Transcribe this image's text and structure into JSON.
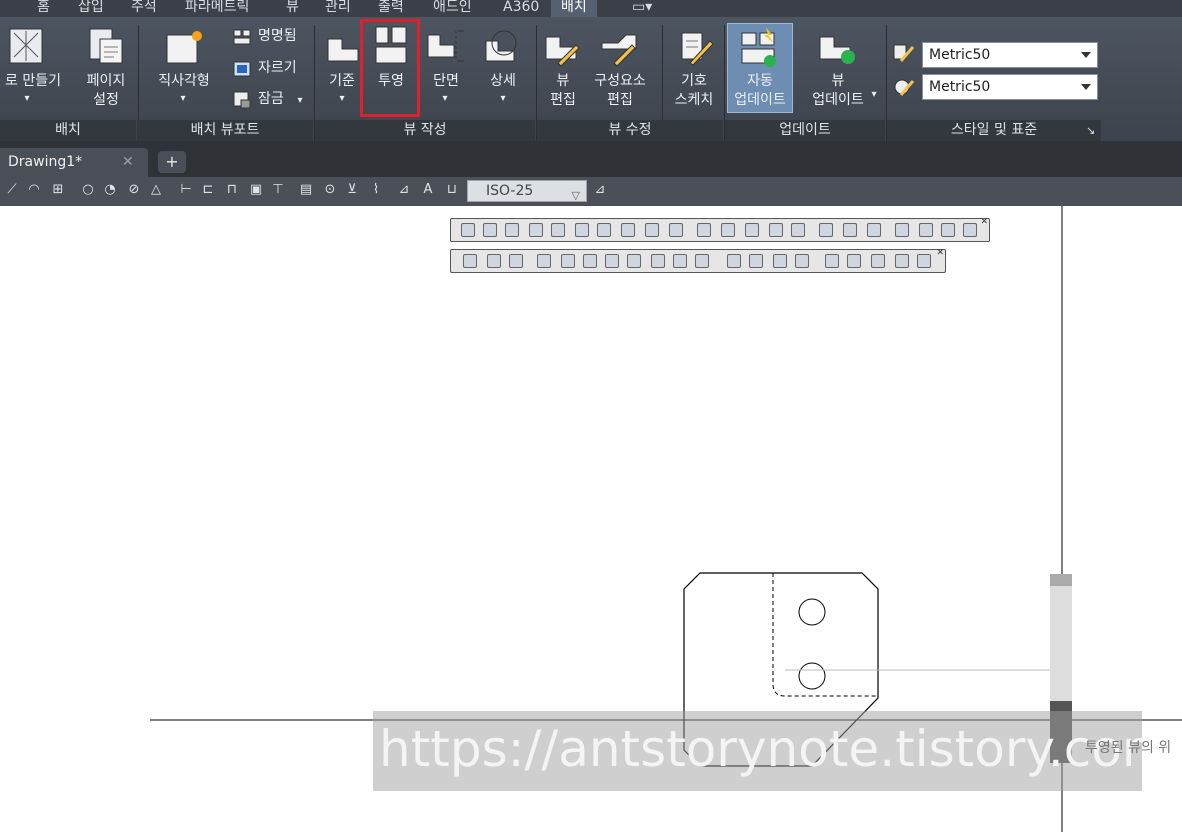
{
  "ribbon_tabs": [
    "홈",
    "삽입",
    "주석",
    "파라메트릭",
    "뷰",
    "관리",
    "출력",
    "애드인",
    "A360",
    "배치"
  ],
  "active_tab": "배치",
  "buttons": {
    "new_layout": "로 만들기",
    "page_setup_1": "페이지",
    "page_setup_2": "설정",
    "rectangular": "직사각형",
    "named": "명명됨",
    "clip": "자르기",
    "lock": "잠금",
    "base": "기준",
    "projected": "투영",
    "section": "단면",
    "detail": "상세",
    "edit_view_1": "뷰",
    "edit_view_2": "편집",
    "edit_comp_1": "구성요소",
    "edit_comp_2": "편집",
    "symbol_1": "기호",
    "symbol_2": "스케치",
    "auto_update_1": "자동",
    "auto_update_2": "업데이트",
    "view_update_1": "뷰",
    "view_update_2": "업데이트"
  },
  "panels": {
    "layout": "배치",
    "layout_viewports": "배치 뷰포트",
    "create_view": "뷰 작성",
    "modify_view": "뷰 수정",
    "update": "업데이트",
    "styles": "스타일 및 표준"
  },
  "styles": {
    "style1": "Metric50",
    "style2": "Metric50"
  },
  "file_tab": "Drawing1*",
  "close_glyph": "✕",
  "plus_glyph": "+",
  "dim_style": "ISO-25",
  "watermark": "https://antstorynote.tistory.com",
  "side_text": "투영된 뷰의 위",
  "highlight_color": "#e0202a"
}
